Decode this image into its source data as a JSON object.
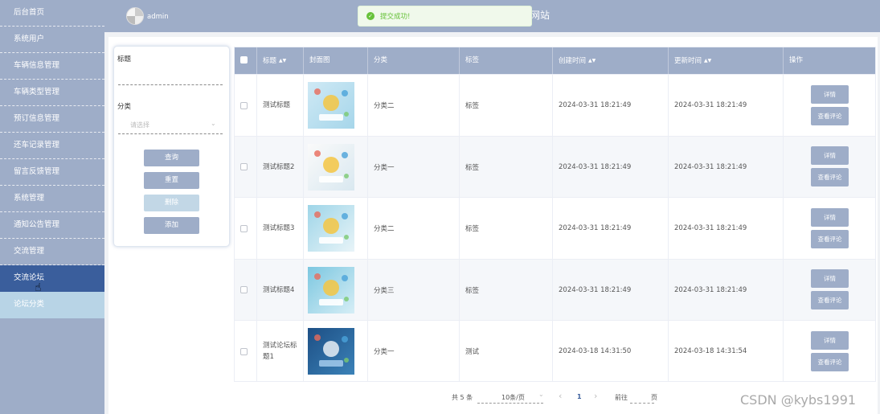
{
  "sidebar": {
    "items": [
      {
        "label": "后台首页"
      },
      {
        "label": "系统用户"
      },
      {
        "label": "车辆信息管理"
      },
      {
        "label": "车辆类型管理"
      },
      {
        "label": "预订信息管理"
      },
      {
        "label": "还车记录管理"
      },
      {
        "label": "留言反馈管理"
      },
      {
        "label": "系统管理"
      },
      {
        "label": "通知公告管理"
      },
      {
        "label": "交流管理"
      },
      {
        "label": "交流论坛"
      },
      {
        "label": "论坛分类"
      }
    ]
  },
  "header": {
    "username": "admin",
    "title_fragment": "网站"
  },
  "toast": {
    "message": "提交成功!"
  },
  "search": {
    "title_label": "标题",
    "category_label": "分类",
    "category_placeholder": "请选择",
    "buttons": {
      "query": "查询",
      "reset": "重置",
      "delete": "删除",
      "add": "添加"
    }
  },
  "table": {
    "headers": {
      "title": "标题",
      "cover": "封面图",
      "category": "分类",
      "tag": "标签",
      "created": "创建时间",
      "updated": "更新时间",
      "actions": "操作"
    },
    "rows": [
      {
        "title": "测试标题",
        "category": "分类二",
        "tag": "标签",
        "created": "2024-03-31 18:21:49",
        "updated": "2024-03-31 18:21:49"
      },
      {
        "title": "测试标题2",
        "category": "分类一",
        "tag": "标签",
        "created": "2024-03-31 18:21:49",
        "updated": "2024-03-31 18:21:49"
      },
      {
        "title": "测试标题3",
        "category": "分类二",
        "tag": "标签",
        "created": "2024-03-31 18:21:49",
        "updated": "2024-03-31 18:21:49"
      },
      {
        "title": "测试标题4",
        "category": "分类三",
        "tag": "标签",
        "created": "2024-03-31 18:21:49",
        "updated": "2024-03-31 18:21:49"
      },
      {
        "title": "测试论坛标题1",
        "category": "分类一",
        "tag": "测试",
        "created": "2024-03-18 14:31:50",
        "updated": "2024-03-18 14:31:54"
      }
    ],
    "row_buttons": {
      "detail": "详情",
      "comments": "查看评论"
    }
  },
  "pagination": {
    "total": "共 5 条",
    "page_size": "10条/页",
    "current_page": "1",
    "goto_label": "前往",
    "page_suffix": "页",
    "prev": "‹",
    "next": "›",
    "dropdown": "⌄"
  },
  "watermark": "CSDN @kybs1991"
}
